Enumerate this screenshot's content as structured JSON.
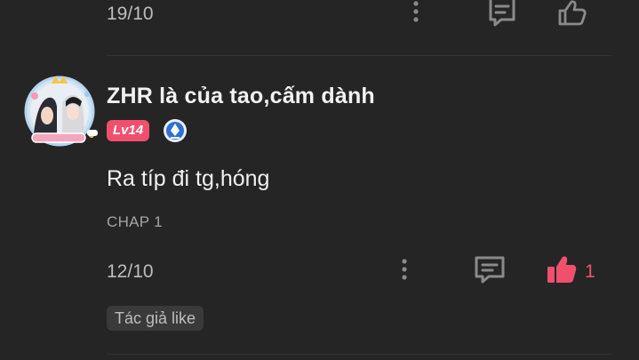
{
  "prev_comment": {
    "date": "19/10",
    "icons": {
      "more": "more-vertical-icon",
      "reply": "comment-icon",
      "like": "thumbs-up-outline-icon"
    }
  },
  "comment": {
    "username": "ZHR là của tao,cấm dành",
    "level": "Lv14",
    "text": "Ra típ đi tg,hóng",
    "chapter": "CHAP 1",
    "date": "12/10",
    "like_count": "1",
    "author_like": "Tác giả like",
    "liked": true,
    "icons": {
      "more": "more-vertical-icon",
      "reply": "comment-icon",
      "like": "thumbs-up-filled-icon",
      "badge": "diamond-rank-icon"
    }
  },
  "colors": {
    "background": "#252525",
    "accent": "#f0506e",
    "rank_badge": "#2f6fd6",
    "muted_text": "#a4a4a4"
  }
}
